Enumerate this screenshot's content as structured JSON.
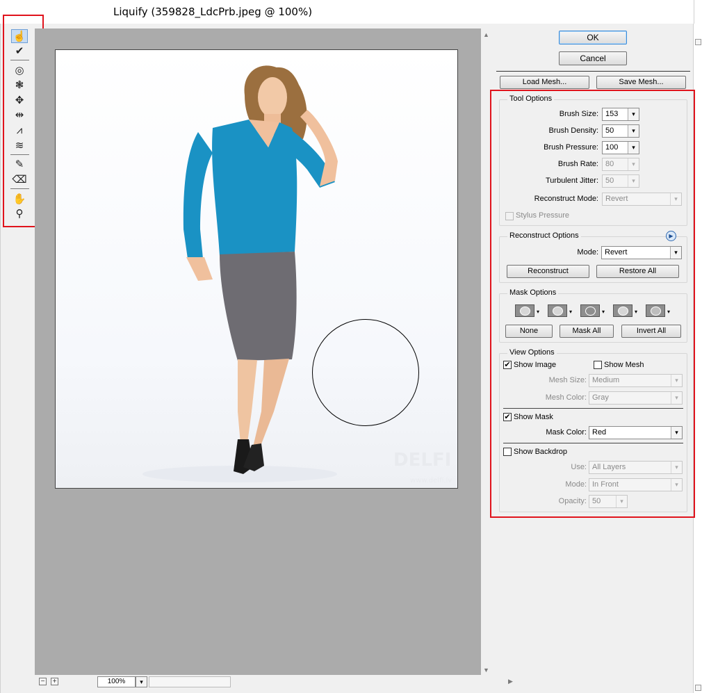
{
  "window": {
    "title": "Liquify (359828_LdcPrb.jpeg @ 100%)"
  },
  "dialog": {
    "ok_label": "OK",
    "cancel_label": "Cancel",
    "load_mesh_label": "Load Mesh...",
    "save_mesh_label": "Save Mesh..."
  },
  "toolbar": {
    "tools": [
      {
        "icon": "forward-warp-tool-icon",
        "glyph": "☝"
      },
      {
        "icon": "reconstruct-tool-icon",
        "glyph": "✔"
      },
      {
        "icon": "twirl-clockwise-tool-icon",
        "glyph": "◎"
      },
      {
        "icon": "pucker-tool-icon",
        "glyph": "❃"
      },
      {
        "icon": "bloat-tool-icon",
        "glyph": "✥"
      },
      {
        "icon": "push-left-tool-icon",
        "glyph": "⇹"
      },
      {
        "icon": "mirror-tool-icon",
        "glyph": "⩘"
      },
      {
        "icon": "turbulence-tool-icon",
        "glyph": "≋"
      },
      {
        "icon": "freeze-mask-tool-icon",
        "glyph": "✎"
      },
      {
        "icon": "thaw-mask-tool-icon",
        "glyph": "⌫"
      },
      {
        "icon": "hand-tool-icon",
        "glyph": "✋"
      },
      {
        "icon": "zoom-tool-icon",
        "glyph": "⚲"
      }
    ]
  },
  "canvas": {
    "zoom": "100%",
    "zoom_out_glyph": "−",
    "zoom_in_glyph": "+",
    "watermark": "DELFI",
    "watermark_sub": "www.delfi.lv"
  },
  "tool_options": {
    "title": "Tool Options",
    "brush_size": {
      "label": "Brush Size:",
      "value": "153"
    },
    "brush_density": {
      "label": "Brush Density:",
      "value": "50"
    },
    "brush_pressure": {
      "label": "Brush Pressure:",
      "value": "100"
    },
    "brush_rate": {
      "label": "Brush Rate:",
      "value": "80"
    },
    "turbulent_jitter": {
      "label": "Turbulent Jitter:",
      "value": "50"
    },
    "reconstruct_mode": {
      "label": "Reconstruct Mode:",
      "value": "Revert"
    },
    "stylus_pressure": {
      "label": "Stylus Pressure",
      "checked": false
    }
  },
  "reconstruct_options": {
    "title": "Reconstruct Options",
    "mode_label": "Mode:",
    "mode_value": "Revert",
    "reconstruct_label": "Reconstruct",
    "restore_all_label": "Restore All"
  },
  "mask_options": {
    "title": "Mask Options",
    "modes": [
      "replace-selection-icon",
      "add-to-selection-icon",
      "subtract-from-selection-icon",
      "intersect-with-selection-icon",
      "invert-selection-icon"
    ],
    "none_label": "None",
    "mask_all_label": "Mask All",
    "invert_all_label": "Invert All"
  },
  "view_options": {
    "title": "View Options",
    "show_image": {
      "label": "Show Image",
      "checked": true
    },
    "show_mesh": {
      "label": "Show Mesh",
      "checked": false
    },
    "mesh_size": {
      "label": "Mesh Size:",
      "value": "Medium"
    },
    "mesh_color": {
      "label": "Mesh Color:",
      "value": "Gray"
    },
    "show_mask": {
      "label": "Show Mask",
      "checked": true
    },
    "mask_color": {
      "label": "Mask Color:",
      "value": "Red"
    },
    "show_backdrop": {
      "label": "Show Backdrop",
      "checked": false
    },
    "use": {
      "label": "Use:",
      "value": "All Layers"
    },
    "mode": {
      "label": "Mode:",
      "value": "In Front"
    },
    "opacity": {
      "label": "Opacity:",
      "value": "50"
    }
  },
  "glyphs": {
    "check": "✔",
    "dropdown": "▾",
    "play": "▶",
    "up_arrow": "▲",
    "down_arrow": "▼",
    "right_arrow": "▶"
  },
  "colors": {
    "highlight_red": "#e0131c",
    "shirt": "#1a92c4",
    "skirt": "#6e6c72",
    "canvas_bg": "#ababab"
  }
}
